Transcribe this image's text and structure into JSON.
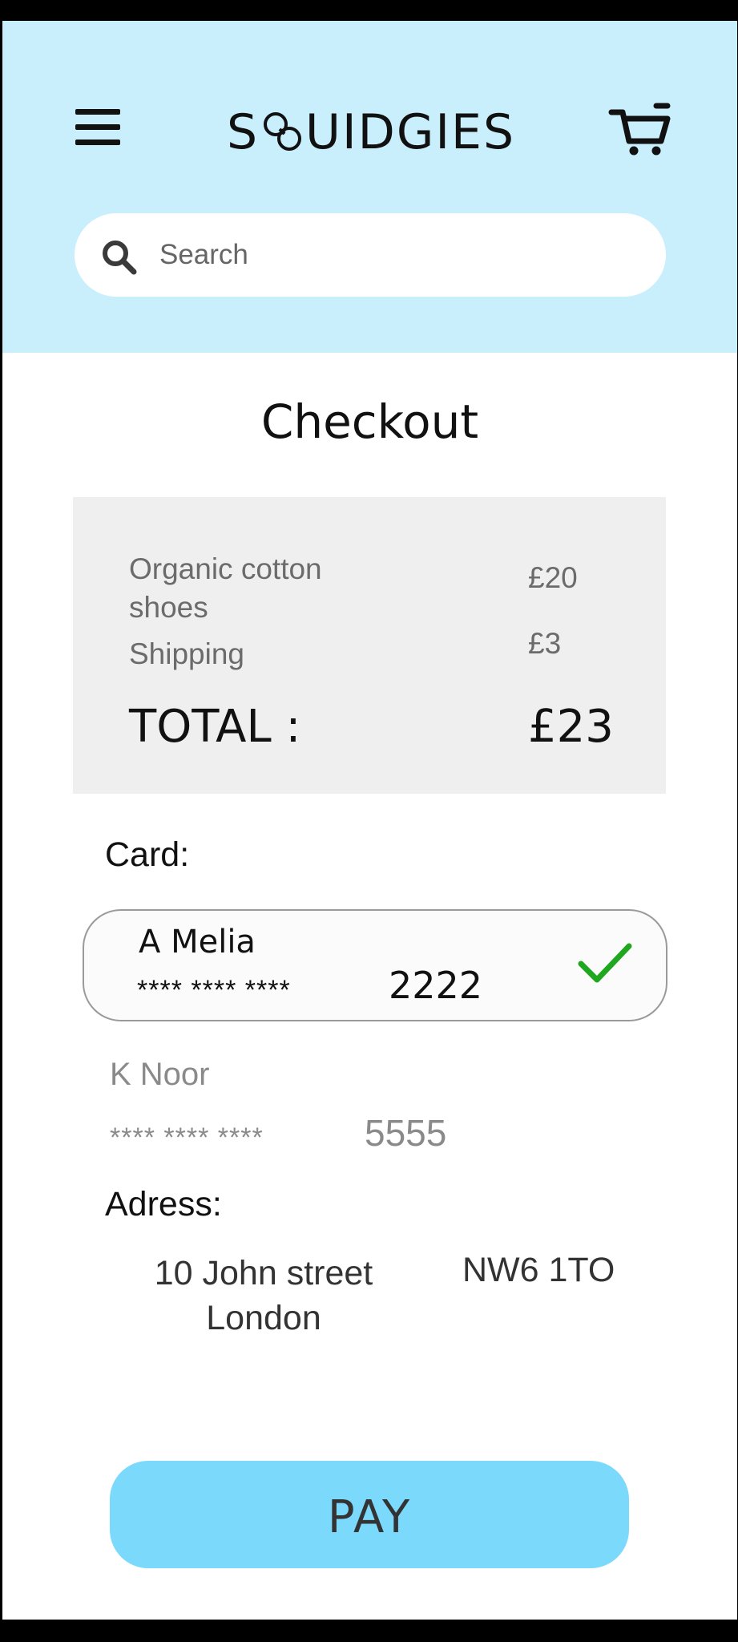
{
  "header": {
    "brand": {
      "first": "S",
      "rest": "UIDGIES"
    },
    "menu_icon": "hamburger-menu-icon",
    "cart_icon": "shopping-cart-icon",
    "search": {
      "placeholder": "Search",
      "icon": "search-icon"
    },
    "background_color": "#c9effc"
  },
  "checkout": {
    "title": "Checkout",
    "summary": {
      "item_name": "Organic cotton shoes",
      "item_price": "£20",
      "shipping_label": "Shipping",
      "shipping_price": "£3",
      "total_label": "TOTAL :",
      "total_value": "£23"
    },
    "card_heading": "Card:",
    "cards": [
      {
        "name": "A Melia",
        "masked": "**** **** ****",
        "last4": "2222",
        "selected": true,
        "check_icon": "checkmark-icon",
        "check_color": "#1fa81f"
      },
      {
        "name": "K Noor",
        "masked": "**** **** ****",
        "last4": "5555",
        "selected": false
      }
    ],
    "address_heading": "Adress:",
    "address": {
      "street": "10 John street London",
      "postcode": "NW6 1TO"
    },
    "pay_label": "PAY",
    "pay_color": "#7bd9fc"
  }
}
